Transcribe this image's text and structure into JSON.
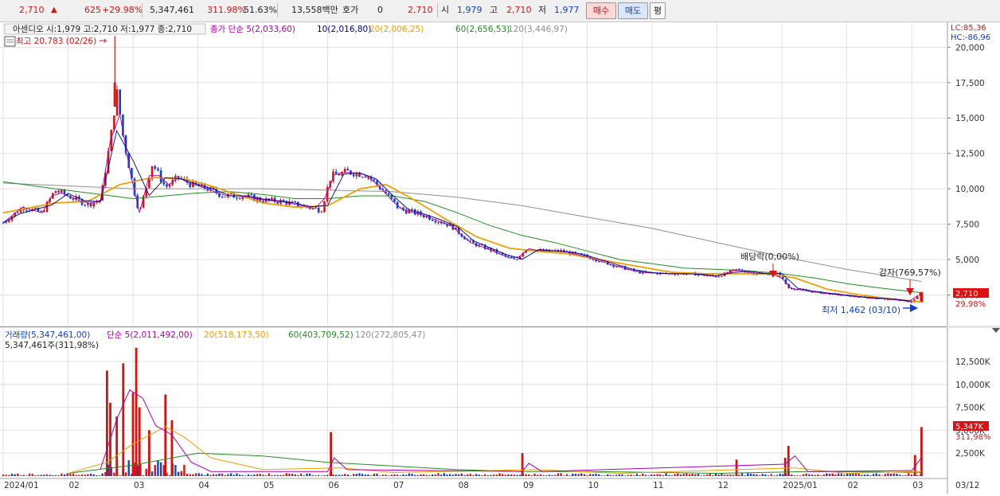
{
  "toolbar": {
    "price": "2,710",
    "arrow": "▲",
    "change": "625",
    "change_pct": "+29.98%",
    "volume": "5,347,461",
    "volume_ratio": "311.98%",
    "turnover": "51.63%",
    "amount": "13,558백만",
    "quote_label": "호가",
    "quote_value": "0",
    "quote_price": "2,710",
    "open_label": "시",
    "open": "1,979",
    "high_label": "고",
    "high": "2,710",
    "low_label": "저",
    "low": "1,977",
    "buy_label": "매수",
    "sell_label": "매도",
    "avg_label": "평"
  },
  "colors": {
    "up": "#e01010",
    "down": "#1040d0",
    "ma5": "#b000b0",
    "ma10": "#000080",
    "ma20": "#f0a000",
    "ma60": "#209020",
    "ma120": "#909090",
    "volume": "#d81010"
  },
  "price_panel": {
    "stock_info": "아센디오 시:1,979 고:2,710 저:1,977 종:2,710",
    "legend": [
      {
        "text": "종가 단순 5(2,033,60)",
        "key": "ma5"
      },
      {
        "text": "10(2,016,80)",
        "key": "ma10"
      },
      {
        "text": "20(2,006,25)",
        "key": "ma20"
      },
      {
        "text": "60(2,656,53)",
        "key": "ma60"
      },
      {
        "text": "120(3,446,97)",
        "key": "ma120"
      }
    ],
    "high_note": "최고 20,783 (02/26)",
    "low_note": "최저 1,462 (03/10)",
    "dividend_note": "배당락(0,00%)",
    "capital_reduction_note": "감자(769,57%)",
    "lc": "LC:85,36",
    "hc": "HC:-86,96",
    "current_tag": "2,710",
    "current_pct": "29,98%"
  },
  "volume_panel": {
    "legend": [
      {
        "text": "거래량(5,347,461,00)",
        "key": "down"
      },
      {
        "text": "단순 5(2,011,492,00)",
        "key": "ma5"
      },
      {
        "text": "20(518,173,50)",
        "key": "ma20"
      },
      {
        "text": "60(403,709,52)",
        "key": "ma60"
      },
      {
        "text": "120(272,805,47)",
        "key": "ma120"
      }
    ],
    "current_volume": "5,347,461주(311,98%)",
    "current_tag": "5,347K",
    "current_pct": "311,98%"
  },
  "chart_data": {
    "type": "candlestick",
    "price_axis": {
      "min": 2500,
      "max": 20000,
      "ticks": [
        "20,000",
        "17,500",
        "15,000",
        "12,500",
        "10,000",
        "7,500",
        "5,000",
        "2,500"
      ]
    },
    "volume_axis": {
      "min": 0,
      "max": 12500,
      "unit": "K",
      "ticks": [
        "12,500K",
        "10,000K",
        "7,500K",
        "5,000K",
        "2,500K"
      ]
    },
    "x_labels": [
      "2024/01",
      "02",
      "03",
      "04",
      "05",
      "06",
      "07",
      "08",
      "09",
      "10",
      "11",
      "12",
      "2025/01",
      "02",
      "03",
      "03/12"
    ],
    "x_label_months": [
      0,
      1,
      2,
      3,
      4,
      5,
      6,
      7,
      8,
      9,
      10,
      11,
      12,
      13,
      14,
      14.35
    ],
    "price_series": {
      "close": [
        {
          "m": 0.0,
          "v": 7600
        },
        {
          "m": 0.3,
          "v": 8700
        },
        {
          "m": 0.6,
          "v": 8300
        },
        {
          "m": 0.8,
          "v": 9900
        },
        {
          "m": 1.1,
          "v": 9300
        },
        {
          "m": 1.3,
          "v": 8900
        },
        {
          "m": 1.5,
          "v": 9200
        },
        {
          "m": 1.65,
          "v": 13400
        },
        {
          "m": 1.75,
          "v": 16900
        },
        {
          "m": 1.85,
          "v": 13600
        },
        {
          "m": 2.0,
          "v": 10200
        },
        {
          "m": 2.1,
          "v": 8300
        },
        {
          "m": 2.3,
          "v": 11800
        },
        {
          "m": 2.5,
          "v": 10100
        },
        {
          "m": 2.7,
          "v": 10800
        },
        {
          "m": 2.9,
          "v": 10300
        },
        {
          "m": 3.1,
          "v": 10100
        },
        {
          "m": 3.4,
          "v": 9500
        },
        {
          "m": 3.7,
          "v": 9500
        },
        {
          "m": 4.0,
          "v": 9200
        },
        {
          "m": 4.3,
          "v": 9100
        },
        {
          "m": 4.6,
          "v": 8800
        },
        {
          "m": 4.9,
          "v": 8500
        },
        {
          "m": 5.05,
          "v": 10900
        },
        {
          "m": 5.3,
          "v": 11200
        },
        {
          "m": 5.6,
          "v": 11000
        },
        {
          "m": 5.85,
          "v": 9900
        },
        {
          "m": 6.1,
          "v": 8600
        },
        {
          "m": 6.5,
          "v": 8100
        },
        {
          "m": 6.9,
          "v": 7400
        },
        {
          "m": 7.2,
          "v": 6200
        },
        {
          "m": 7.5,
          "v": 5700
        },
        {
          "m": 7.9,
          "v": 4900
        },
        {
          "m": 8.05,
          "v": 5800
        },
        {
          "m": 8.3,
          "v": 5600
        },
        {
          "m": 8.6,
          "v": 5600
        },
        {
          "m": 9.0,
          "v": 5200
        },
        {
          "m": 9.4,
          "v": 4600
        },
        {
          "m": 9.8,
          "v": 4100
        },
        {
          "m": 10.2,
          "v": 4000
        },
        {
          "m": 10.6,
          "v": 4000
        },
        {
          "m": 11.0,
          "v": 3800
        },
        {
          "m": 11.3,
          "v": 4300
        },
        {
          "m": 11.6,
          "v": 4000
        },
        {
          "m": 11.95,
          "v": 4000
        },
        {
          "m": 12.1,
          "v": 3000
        },
        {
          "m": 12.5,
          "v": 2700
        },
        {
          "m": 12.9,
          "v": 2500
        },
        {
          "m": 13.3,
          "v": 2300
        },
        {
          "m": 13.7,
          "v": 2200
        },
        {
          "m": 14.0,
          "v": 2000
        },
        {
          "m": 14.15,
          "v": 2710
        }
      ],
      "ma20": [
        {
          "m": 0.0,
          "v": 8300
        },
        {
          "m": 0.8,
          "v": 9000
        },
        {
          "m": 1.3,
          "v": 9100
        },
        {
          "m": 1.8,
          "v": 10300
        },
        {
          "m": 2.3,
          "v": 10800
        },
        {
          "m": 2.8,
          "v": 10700
        },
        {
          "m": 3.2,
          "v": 10200
        },
        {
          "m": 3.6,
          "v": 9600
        },
        {
          "m": 4.0,
          "v": 9000
        },
        {
          "m": 4.5,
          "v": 8700
        },
        {
          "m": 5.0,
          "v": 8800
        },
        {
          "m": 5.5,
          "v": 10000
        },
        {
          "m": 5.9,
          "v": 10300
        },
        {
          "m": 6.3,
          "v": 9300
        },
        {
          "m": 6.8,
          "v": 7900
        },
        {
          "m": 7.3,
          "v": 6600
        },
        {
          "m": 7.8,
          "v": 5800
        },
        {
          "m": 8.2,
          "v": 5600
        },
        {
          "m": 8.7,
          "v": 5400
        },
        {
          "m": 9.3,
          "v": 4900
        },
        {
          "m": 9.8,
          "v": 4500
        },
        {
          "m": 10.3,
          "v": 4100
        },
        {
          "m": 10.8,
          "v": 4000
        },
        {
          "m": 11.3,
          "v": 4000
        },
        {
          "m": 11.8,
          "v": 4000
        },
        {
          "m": 12.2,
          "v": 3700
        },
        {
          "m": 12.7,
          "v": 2900
        },
        {
          "m": 13.2,
          "v": 2500
        },
        {
          "m": 13.7,
          "v": 2200
        },
        {
          "m": 14.15,
          "v": 2000
        }
      ],
      "ma60": [
        {
          "m": 0.0,
          "v": 10500
        },
        {
          "m": 0.8,
          "v": 10000
        },
        {
          "m": 1.5,
          "v": 9600
        },
        {
          "m": 2.0,
          "v": 9300
        },
        {
          "m": 2.5,
          "v": 9500
        },
        {
          "m": 3.0,
          "v": 9700
        },
        {
          "m": 3.5,
          "v": 9800
        },
        {
          "m": 4.0,
          "v": 9600
        },
        {
          "m": 4.5,
          "v": 9300
        },
        {
          "m": 5.0,
          "v": 9300
        },
        {
          "m": 5.5,
          "v": 9500
        },
        {
          "m": 6.0,
          "v": 9500
        },
        {
          "m": 6.5,
          "v": 9100
        },
        {
          "m": 7.0,
          "v": 8300
        },
        {
          "m": 7.5,
          "v": 7400
        },
        {
          "m": 8.0,
          "v": 6700
        },
        {
          "m": 8.5,
          "v": 6200
        },
        {
          "m": 9.0,
          "v": 5600
        },
        {
          "m": 9.5,
          "v": 5000
        },
        {
          "m": 10.0,
          "v": 4700
        },
        {
          "m": 10.5,
          "v": 4400
        },
        {
          "m": 11.0,
          "v": 4300
        },
        {
          "m": 11.5,
          "v": 4200
        },
        {
          "m": 12.0,
          "v": 4000
        },
        {
          "m": 12.5,
          "v": 3700
        },
        {
          "m": 13.0,
          "v": 3300
        },
        {
          "m": 13.5,
          "v": 3000
        },
        {
          "m": 14.15,
          "v": 2657
        }
      ],
      "ma120": [
        {
          "m": 0.0,
          "v": 10400
        },
        {
          "m": 1.0,
          "v": 10200
        },
        {
          "m": 2.0,
          "v": 10000
        },
        {
          "m": 3.0,
          "v": 10000
        },
        {
          "m": 4.0,
          "v": 10000
        },
        {
          "m": 5.0,
          "v": 9900
        },
        {
          "m": 6.0,
          "v": 9800
        },
        {
          "m": 7.0,
          "v": 9400
        },
        {
          "m": 8.0,
          "v": 8800
        },
        {
          "m": 9.0,
          "v": 8000
        },
        {
          "m": 10.0,
          "v": 7200
        },
        {
          "m": 11.0,
          "v": 6200
        },
        {
          "m": 12.0,
          "v": 5200
        },
        {
          "m": 13.0,
          "v": 4300
        },
        {
          "m": 14.15,
          "v": 3447
        }
      ]
    },
    "volume_series": {
      "spikes_k": [
        {
          "m": 1.6,
          "v": 11500
        },
        {
          "m": 1.65,
          "v": 8000
        },
        {
          "m": 1.75,
          "v": 6500
        },
        {
          "m": 1.85,
          "v": 12300
        },
        {
          "m": 2.0,
          "v": 9100
        },
        {
          "m": 2.05,
          "v": 14000
        },
        {
          "m": 2.1,
          "v": 7500
        },
        {
          "m": 2.25,
          "v": 5000
        },
        {
          "m": 2.5,
          "v": 8900
        },
        {
          "m": 2.6,
          "v": 6100
        },
        {
          "m": 5.05,
          "v": 4800
        },
        {
          "m": 8.0,
          "v": 2500
        },
        {
          "m": 11.3,
          "v": 1800
        },
        {
          "m": 12.05,
          "v": 2000
        },
        {
          "m": 12.1,
          "v": 3300
        },
        {
          "m": 14.05,
          "v": 2300
        },
        {
          "m": 14.15,
          "v": 5347
        }
      ],
      "ma5_k": [
        {
          "m": 1.5,
          "v": 800
        },
        {
          "m": 1.75,
          "v": 6200
        },
        {
          "m": 1.95,
          "v": 9400
        },
        {
          "m": 2.15,
          "v": 8500
        },
        {
          "m": 2.35,
          "v": 5500
        },
        {
          "m": 2.6,
          "v": 4500
        },
        {
          "m": 2.9,
          "v": 1500
        },
        {
          "m": 3.2,
          "v": 500
        },
        {
          "m": 5.0,
          "v": 500
        },
        {
          "m": 5.1,
          "v": 2000
        },
        {
          "m": 5.3,
          "v": 700
        },
        {
          "m": 8.0,
          "v": 500
        },
        {
          "m": 8.1,
          "v": 1400
        },
        {
          "m": 8.3,
          "v": 500
        },
        {
          "m": 12.05,
          "v": 1300
        },
        {
          "m": 12.2,
          "v": 2200
        },
        {
          "m": 12.4,
          "v": 500
        },
        {
          "m": 14.0,
          "v": 600
        },
        {
          "m": 14.15,
          "v": 2011
        }
      ],
      "ma20_k": [
        {
          "m": 1.0,
          "v": 300
        },
        {
          "m": 1.6,
          "v": 1500
        },
        {
          "m": 2.0,
          "v": 3500
        },
        {
          "m": 2.5,
          "v": 5400
        },
        {
          "m": 2.8,
          "v": 4200
        },
        {
          "m": 3.2,
          "v": 2000
        },
        {
          "m": 4.0,
          "v": 700
        },
        {
          "m": 5.2,
          "v": 900
        },
        {
          "m": 6.0,
          "v": 400
        },
        {
          "m": 8.2,
          "v": 700
        },
        {
          "m": 9.5,
          "v": 300
        },
        {
          "m": 12.2,
          "v": 900
        },
        {
          "m": 13.0,
          "v": 300
        },
        {
          "m": 14.15,
          "v": 518
        }
      ],
      "ma60_k": [
        {
          "m": 1.0,
          "v": 300
        },
        {
          "m": 2.0,
          "v": 1200
        },
        {
          "m": 3.0,
          "v": 2500
        },
        {
          "m": 4.0,
          "v": 2200
        },
        {
          "m": 5.0,
          "v": 1500
        },
        {
          "m": 6.0,
          "v": 1100
        },
        {
          "m": 7.0,
          "v": 700
        },
        {
          "m": 8.0,
          "v": 500
        },
        {
          "m": 9.0,
          "v": 500
        },
        {
          "m": 11.0,
          "v": 300
        },
        {
          "m": 12.5,
          "v": 500
        },
        {
          "m": 14.15,
          "v": 404
        }
      ]
    }
  }
}
